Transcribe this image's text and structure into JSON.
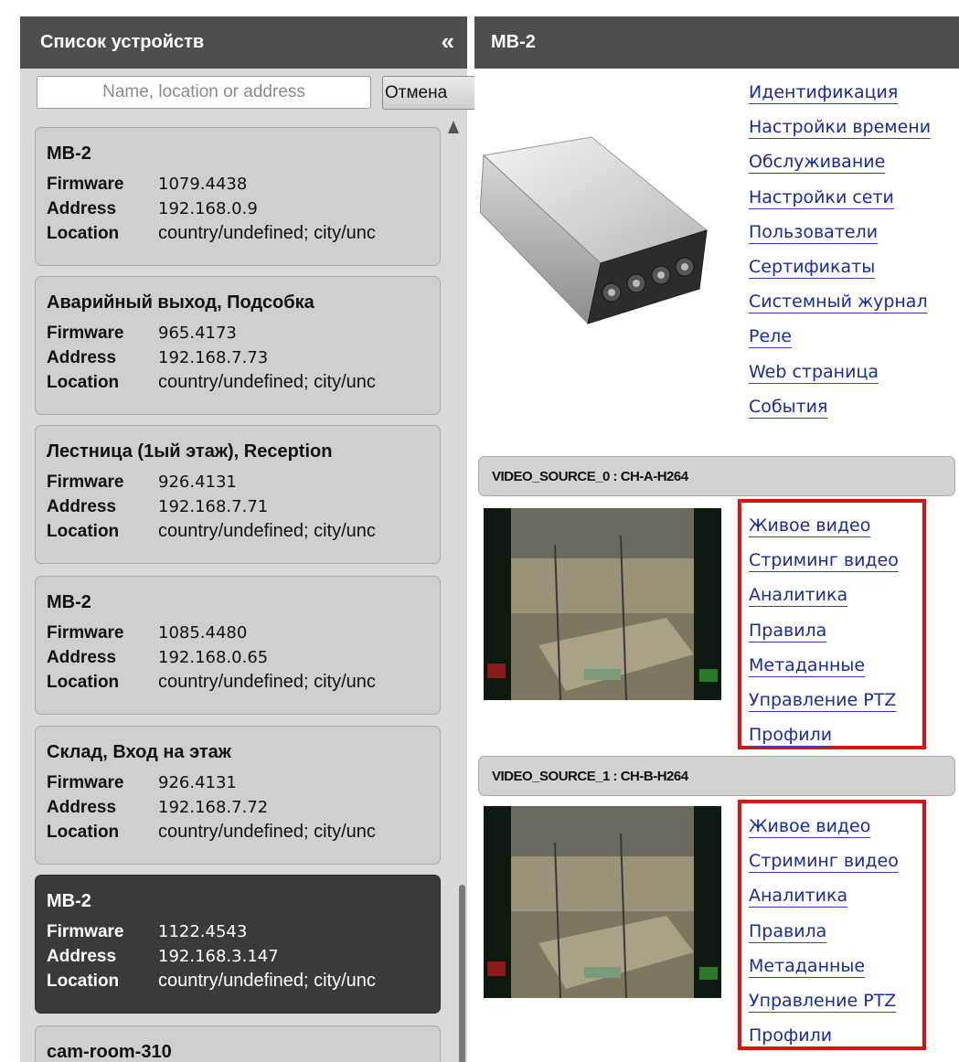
{
  "sidebar": {
    "title": "Список устройств",
    "collapse_symbol": "«",
    "search_placeholder": "Name, location or address",
    "cancel_label": "Отмена",
    "field_labels": {
      "firmware": "Firmware",
      "address": "Address",
      "location": "Location"
    },
    "devices": [
      {
        "name": "MB-2",
        "firmware": "1079.4438",
        "address": "192.168.0.9",
        "location": "country/undefined; city/unc"
      },
      {
        "name": "Аварийный выход, Подсобка",
        "firmware": "965.4173",
        "address": "192.168.7.73",
        "location": "country/undefined; city/unc"
      },
      {
        "name": "Лестница (1ый этаж), Reception",
        "firmware": "926.4131",
        "address": "192.168.7.71",
        "location": "country/undefined; city/unc"
      },
      {
        "name": "MB-2",
        "firmware": "1085.4480",
        "address": "192.168.0.65",
        "location": "country/undefined; city/unc"
      },
      {
        "name": "Склад, Вход на этаж",
        "firmware": "926.4131",
        "address": "192.168.7.72",
        "location": "country/undefined; city/unc"
      },
      {
        "name": "MB-2",
        "firmware": "1122.4543",
        "address": "192.168.3.147",
        "location": "country/undefined; city/unc",
        "selected": true
      },
      {
        "name": "cam-room-310"
      }
    ]
  },
  "detail": {
    "title": "MB-2",
    "device_links": [
      "Идентификация",
      "Настройки времени",
      "Обслуживание",
      "Настройки сети",
      "Пользователи",
      "Сертификаты",
      "Системный журнал",
      "Реле",
      "Web страница",
      "События"
    ],
    "video_sources": [
      {
        "header": "VIDEO_SOURCE_0 : CH-A-H264",
        "links": [
          "Живое видео",
          "Стриминг видео",
          "Аналитика",
          "Правила",
          "Метаданные",
          "Управление PTZ",
          "Профили"
        ]
      },
      {
        "header": "VIDEO_SOURCE_1 : CH-B-H264",
        "links": [
          "Живое видео",
          "Стриминг видео",
          "Аналитика",
          "Правила",
          "Метаданные",
          "Управление PTZ",
          "Профили"
        ]
      }
    ],
    "highlight_color": "#e01010",
    "link_color": "#1a2aa0"
  }
}
